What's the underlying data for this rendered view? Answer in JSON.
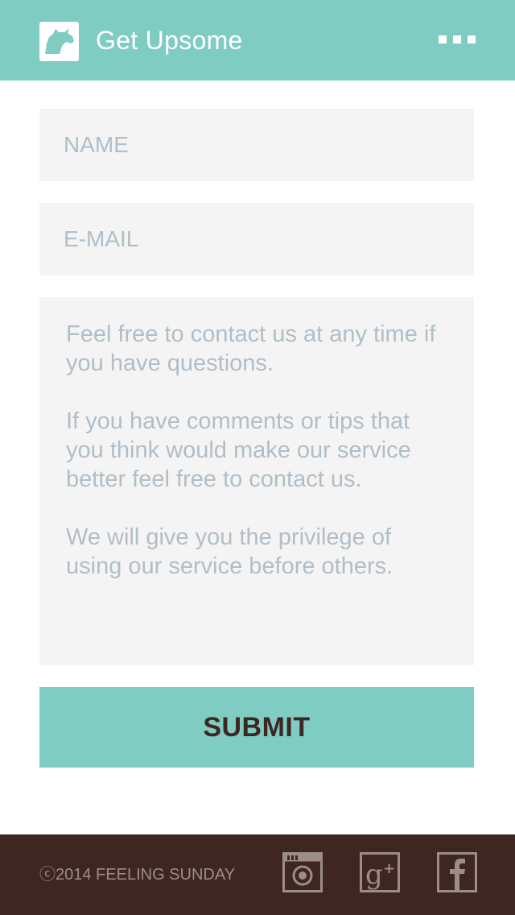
{
  "header": {
    "title": "Get Upsome",
    "logo_icon": "goat-head-icon",
    "menu_icon": "more-dots-icon"
  },
  "form": {
    "name_placeholder": "NAME",
    "email_placeholder": "E-MAIL",
    "message_placeholder": "Feel free to contact us at any time if you have questions.\n\nIf you have comments or tips that you think would make our service better feel free to contact us.\n\nWe will give you the privilege of using our service before others.",
    "submit_label": "SUBMIT"
  },
  "footer": {
    "copyright": "ⓒ2014 FEELING SUNDAY",
    "social": [
      {
        "icon": "instagram-icon"
      },
      {
        "icon": "google-plus-icon"
      },
      {
        "icon": "facebook-icon"
      }
    ]
  },
  "colors": {
    "accent": "#7fccc3",
    "footer_bg": "#3e2723",
    "field_bg": "#f4f4f4",
    "placeholder": "#b0bec7",
    "submit_text": "#3e2723",
    "footer_text": "#9c8d89"
  }
}
